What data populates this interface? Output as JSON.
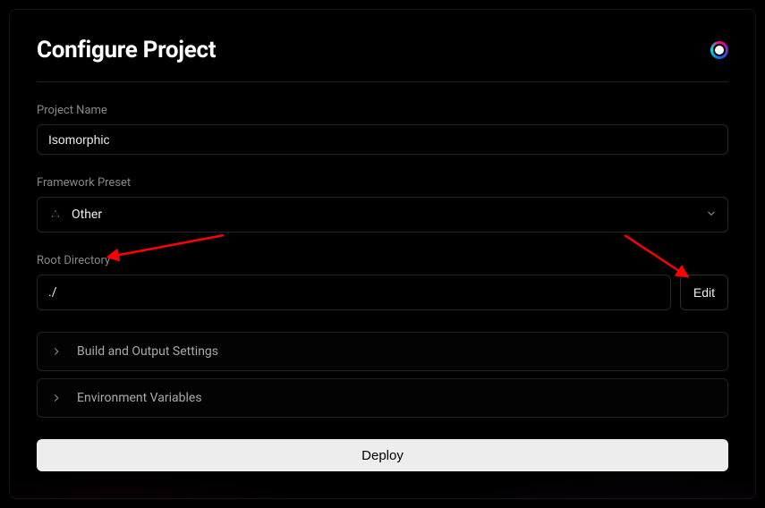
{
  "title": "Configure Project",
  "fields": {
    "projectName": {
      "label": "Project Name",
      "value": "Isomorphic"
    },
    "frameworkPreset": {
      "label": "Framework Preset",
      "value": "Other"
    },
    "rootDirectory": {
      "label": "Root Directory",
      "value": "./",
      "editLabel": "Edit"
    }
  },
  "accordions": {
    "buildOutput": "Build and Output Settings",
    "envVars": "Environment Variables"
  },
  "actions": {
    "deploy": "Deploy"
  }
}
